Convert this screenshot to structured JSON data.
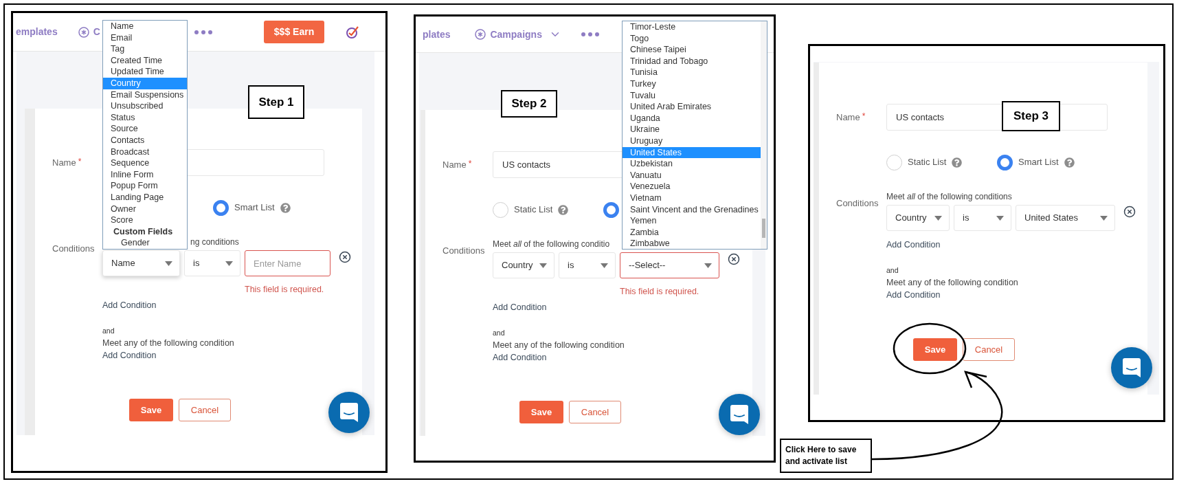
{
  "panels": [
    {
      "step": "Step 1",
      "nav": {
        "links": [
          {
            "kind": "plain",
            "label": "emplates"
          },
          {
            "kind": "menu",
            "label": "C"
          }
        ],
        "more": true,
        "earn_button": "$$$ Earn",
        "logo": true
      },
      "name": {
        "label": "Name",
        "required_mark": "*"
      },
      "radios": [
        {
          "label": "Smart List",
          "selected": true
        }
      ],
      "conditions": {
        "label": "Conditions",
        "intro": "ng conditions",
        "rule": [
          {
            "kind": "select",
            "value": "Name",
            "focused": true,
            "invalid": false
          },
          {
            "kind": "select",
            "value": "is",
            "focused": false,
            "invalid": false
          },
          {
            "kind": "input",
            "placeholder": "Enter Name",
            "focused": false,
            "invalid": true
          }
        ],
        "error": "This field is required.",
        "add": "Add Condition"
      },
      "any": {
        "joiner": "and",
        "intro": "Meet any of the following condition",
        "add": "Add Condition"
      },
      "buttons": {
        "save": "Save",
        "cancel": "Cancel"
      },
      "dropdown": {
        "items": [
          {
            "kind": "option",
            "label": "Name",
            "selected": false
          },
          {
            "kind": "option",
            "label": "Email",
            "selected": false
          },
          {
            "kind": "option",
            "label": "Tag",
            "selected": false
          },
          {
            "kind": "option",
            "label": "Created Time",
            "selected": false
          },
          {
            "kind": "option",
            "label": "Updated Time",
            "selected": false
          },
          {
            "kind": "option",
            "label": "Country",
            "selected": true
          },
          {
            "kind": "option",
            "label": "Email Suspensions",
            "selected": false
          },
          {
            "kind": "option",
            "label": "Unsubscribed",
            "selected": false
          },
          {
            "kind": "option",
            "label": "Status",
            "selected": false
          },
          {
            "kind": "option",
            "label": "Source",
            "selected": false
          },
          {
            "kind": "option",
            "label": "Contacts",
            "selected": false
          },
          {
            "kind": "option",
            "label": "Broadcast",
            "selected": false
          },
          {
            "kind": "option",
            "label": "Sequence",
            "selected": false
          },
          {
            "kind": "option",
            "label": "Inline Form",
            "selected": false
          },
          {
            "kind": "option",
            "label": "Popup Form",
            "selected": false
          },
          {
            "kind": "option",
            "label": "Landing Page",
            "selected": false
          },
          {
            "kind": "option",
            "label": "Owner",
            "selected": false
          },
          {
            "kind": "option",
            "label": "Score",
            "selected": false
          },
          {
            "kind": "group",
            "label": "Custom Fields",
            "children": [
              {
                "kind": "option",
                "label": "Gender",
                "selected": false
              }
            ]
          }
        ]
      }
    },
    {
      "step": "Step 2",
      "nav": {
        "links": [
          {
            "kind": "plain",
            "label": "plates"
          },
          {
            "kind": "menu-dropdown",
            "label": "Campaigns"
          }
        ],
        "more": true
      },
      "name": {
        "label": "Name",
        "required_mark": "*",
        "value": "US contacts"
      },
      "radios": [
        {
          "label": "Static List",
          "selected": false
        },
        {
          "selected": true
        }
      ],
      "conditions": {
        "label": "Conditions",
        "intro": "Meet *all* of the following conditio",
        "rule": [
          {
            "kind": "select",
            "value": "Country",
            "focused": false,
            "invalid": false
          },
          {
            "kind": "select",
            "value": "is",
            "focused": false,
            "invalid": false
          },
          {
            "kind": "select",
            "value": "--Select--",
            "focused": false,
            "invalid": true
          }
        ],
        "error": "This field is required.",
        "add": "Add Condition"
      },
      "any": {
        "joiner": "and",
        "intro": "Meet any of the following condition",
        "add": "Add Condition"
      },
      "buttons": {
        "save": "Save",
        "cancel": "Cancel"
      },
      "dropdown": {
        "items": [
          {
            "kind": "option",
            "label": "Timor-Leste",
            "selected": false
          },
          {
            "kind": "option",
            "label": "Togo",
            "selected": false
          },
          {
            "kind": "option",
            "label": "Chinese Taipei",
            "selected": false
          },
          {
            "kind": "option",
            "label": "Trinidad and Tobago",
            "selected": false
          },
          {
            "kind": "option",
            "label": "Tunisia",
            "selected": false
          },
          {
            "kind": "option",
            "label": "Turkey",
            "selected": false
          },
          {
            "kind": "option",
            "label": "Tuvalu",
            "selected": false
          },
          {
            "kind": "option",
            "label": "United Arab Emirates",
            "selected": false
          },
          {
            "kind": "option",
            "label": "Uganda",
            "selected": false
          },
          {
            "kind": "option",
            "label": "Ukraine",
            "selected": false
          },
          {
            "kind": "option",
            "label": "Uruguay",
            "selected": false
          },
          {
            "kind": "option",
            "label": "United States",
            "selected": true
          },
          {
            "kind": "option",
            "label": "Uzbekistan",
            "selected": false
          },
          {
            "kind": "option",
            "label": "Vanuatu",
            "selected": false
          },
          {
            "kind": "option",
            "label": "Venezuela",
            "selected": false
          },
          {
            "kind": "option",
            "label": "Vietnam",
            "selected": false
          },
          {
            "kind": "option",
            "label": "Saint Vincent and the Grenadines",
            "selected": false
          },
          {
            "kind": "option",
            "label": "Yemen",
            "selected": false
          },
          {
            "kind": "option",
            "label": "Zambia",
            "selected": false
          },
          {
            "kind": "option",
            "label": "Zimbabwe",
            "selected": false
          }
        ]
      }
    },
    {
      "step": "Step 3",
      "name": {
        "label": "Name",
        "required_mark": "*",
        "value": "US contacts"
      },
      "radios": [
        {
          "label": "Static List",
          "selected": false
        },
        {
          "label": "Smart List",
          "selected": true
        }
      ],
      "conditions": {
        "label": "Conditions",
        "intro": "Meet *all* of the following conditions",
        "rule": [
          {
            "kind": "select",
            "value": "Country",
            "focused": false,
            "invalid": false
          },
          {
            "kind": "select",
            "value": "is",
            "focused": false,
            "invalid": false
          },
          {
            "kind": "select",
            "value": "United States",
            "focused": false,
            "invalid": false
          }
        ],
        "add": "Add Condition"
      },
      "any": {
        "joiner": "and",
        "intro": "Meet any of the following condition",
        "add": "Add Condition"
      },
      "buttons": {
        "save": "Save",
        "cancel": "Cancel"
      }
    }
  ],
  "annotation": {
    "text": "Click Here to save and activate list"
  }
}
